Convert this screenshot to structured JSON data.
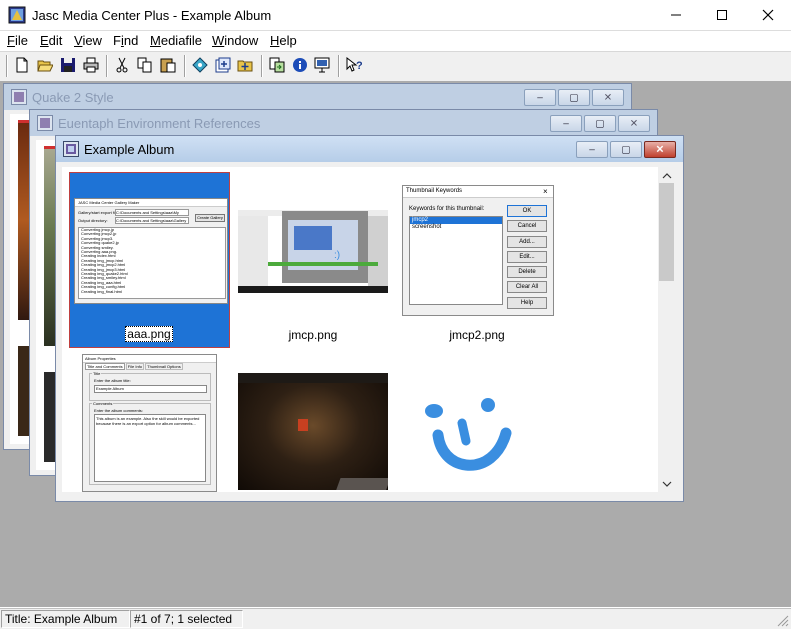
{
  "app": {
    "title": "Jasc Media Center Plus - Example Album"
  },
  "menu": {
    "items": [
      {
        "label": "File",
        "ul": "F",
        "rest": "ile"
      },
      {
        "label": "Edit",
        "ul": "E",
        "rest": "dit"
      },
      {
        "label": "View",
        "ul": "V",
        "rest": "iew"
      },
      {
        "label": "Find",
        "pre": "F",
        "ul": "i",
        "rest": "nd"
      },
      {
        "label": "Mediafile",
        "ul": "M",
        "rest": "ediafile"
      },
      {
        "label": "Window",
        "ul": "W",
        "rest": "indow"
      },
      {
        "label": "Help",
        "ul": "H",
        "rest": "elp"
      }
    ]
  },
  "toolbar": {
    "icons": [
      "new-icon",
      "open-icon",
      "save-icon",
      "print-icon",
      "cut-icon",
      "copy-icon",
      "paste-icon",
      "find-icon",
      "add-album-icon",
      "add-file-icon",
      "import-icon",
      "info-icon",
      "slideshow-icon",
      "context-help-icon"
    ]
  },
  "windows": {
    "back1": {
      "title": "Quake 2 Style"
    },
    "back2": {
      "title": "Euentaph Environment References"
    },
    "front": {
      "title": "Example Album"
    }
  },
  "thumbnails": [
    {
      "name": "aaa.png",
      "selected": true
    },
    {
      "name": "jmcp.png",
      "selected": false
    },
    {
      "name": "jmcp2.png",
      "selected": false
    },
    {
      "name": "",
      "selected": false
    },
    {
      "name": "",
      "selected": false
    },
    {
      "name": "",
      "selected": false
    }
  ],
  "thumb1_dialog": {
    "title": "JASC Media Center Gallery Maker",
    "row1_label": "Gallery/start export file:",
    "row1_value": "C:\\Documents and Settings\\aaa\\My Documents\\Gallery",
    "row2_label": "Output directory:",
    "row2_value": "C:\\Documents and Settings\\aaa\\Gallery",
    "button": "Create Gallery",
    "log": [
      "Converting jmcp.jp",
      "Converting jmcp2.jp",
      "Converting jmcp3.",
      "Converting quake2.jp",
      "Converting smiley.",
      "Converting aaa.png.",
      "Creating index.html",
      "Creating img_jmcp.html",
      "Creating img_jmcp2.html",
      "Creating img_jmcp3.html",
      "Creating img_quake2.html",
      "Creating img_smiley.html",
      "Creating img_aaa.html",
      "Creating img_config.html",
      "Creating img_final.html"
    ]
  },
  "thumb3_dialog": {
    "title": "Thumbnail Keywords",
    "label": "Keywords for this thumbnail:",
    "keywords": [
      "jmcp2",
      "screenshot"
    ],
    "buttons": [
      "OK",
      "Cancel",
      "Add...",
      "Edit...",
      "Delete",
      "Clear All",
      "Help"
    ]
  },
  "thumb4_dialog": {
    "title": "Album Properties",
    "tabs": [
      "Title and Comments",
      "File Info",
      "Thumbnail Options"
    ],
    "title_group": "Title",
    "title_label": "Enter the album title:",
    "title_value": "Example Album",
    "comments_group": "Comments",
    "comments_label": "Enter the album comments:",
    "comments_text": "This album is an example. Also the skill would be exported because there is an export option for album comments..."
  },
  "statusbar": {
    "title": "Title: Example Album",
    "count": "#1 of 7; 1 selected"
  },
  "colors": {
    "mdi_background": "#ababab",
    "selection": "#1e73d6",
    "smiley": "#3a8ee0"
  }
}
